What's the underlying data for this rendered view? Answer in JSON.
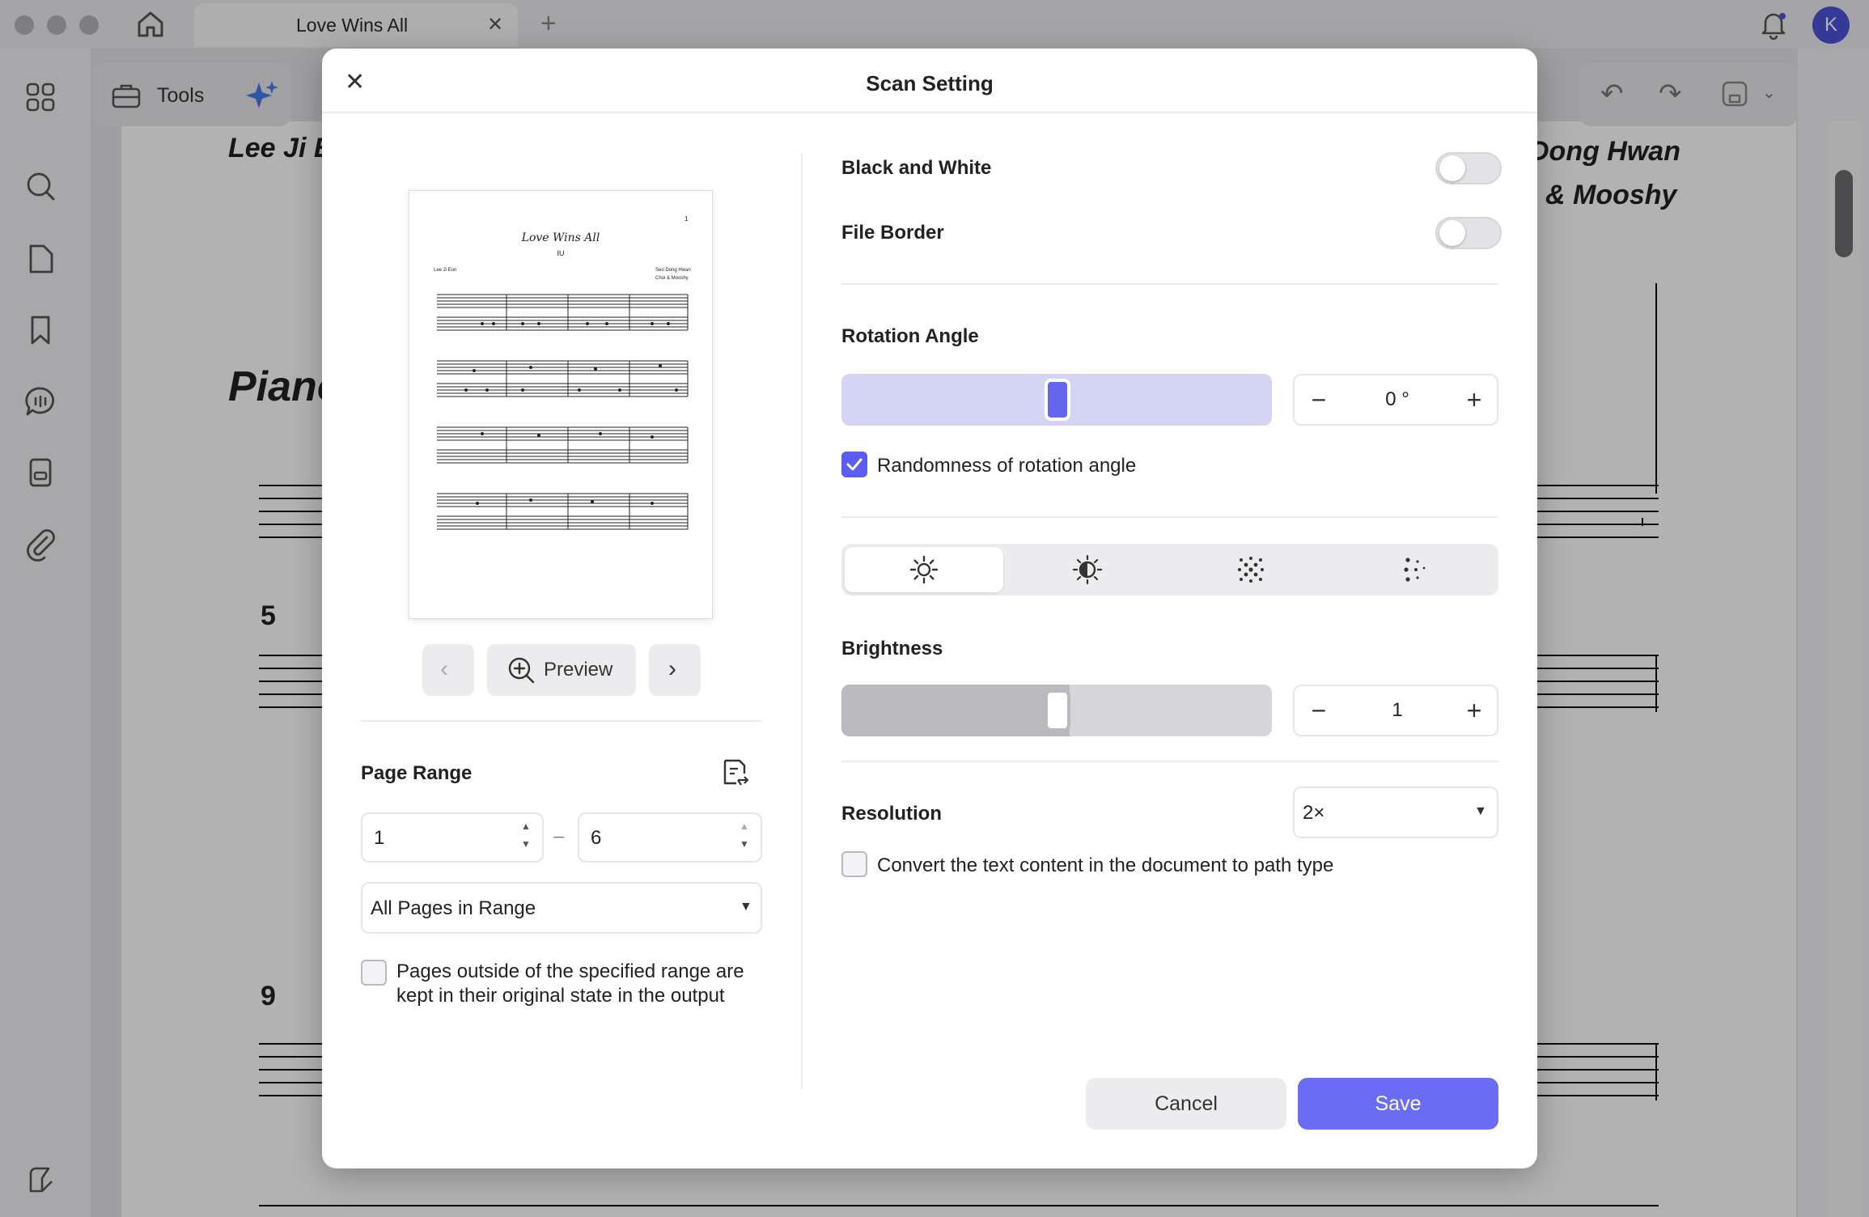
{
  "window": {
    "tab_title": "Love Wins All",
    "avatar_letter": "K"
  },
  "toolbar": {
    "tools_label": "Tools"
  },
  "background_document": {
    "left_header": "Lee Ji E",
    "right_header_1": "Dong Hwan",
    "right_header_2": "& Mooshy",
    "instrument": "Piano",
    "measure_5": "5",
    "measure_9": "9"
  },
  "dialog": {
    "title": "Scan Setting",
    "preview": {
      "sheet_title": "Love Wins All",
      "sheet_subtitle": "IU",
      "sheet_left_credit": "Lee Ji Eun",
      "sheet_right_credit_1": "Seo Dong Hwan",
      "sheet_right_credit_2": "Choi & Mooshy",
      "sheet_page_number": "1",
      "preview_button": "Preview"
    },
    "page_range": {
      "label": "Page Range",
      "from": "1",
      "dash": "–",
      "to": "6",
      "selection": "All Pages in Range",
      "keep_outside_label": "Pages outside of the specified range are kept in their original state in the output",
      "keep_outside_checked": false
    },
    "settings": {
      "black_white_label": "Black and White",
      "black_white_on": false,
      "file_border_label": "File Border",
      "file_border_on": false,
      "rotation_label": "Rotation Angle",
      "rotation_value": "0 °",
      "rotation_position": 0.5,
      "randomness_label": "Randomness of rotation angle",
      "randomness_checked": true,
      "adjust_tabs": [
        "brightness-icon",
        "contrast-icon",
        "sharpness-icon",
        "noise-icon"
      ],
      "active_adjust_tab": 0,
      "brightness_label": "Brightness",
      "brightness_value": "1",
      "brightness_position": 0.5,
      "resolution_label": "Resolution",
      "resolution_value": "2×",
      "convert_text_label": "Convert the text content in the document to path type",
      "convert_text_checked": false
    },
    "cancel_label": "Cancel",
    "save_label": "Save"
  },
  "colors": {
    "accent": "#5b5cf0",
    "save_button": "#6a6cf5",
    "rotation_slider": "#d4d5f4",
    "brightness_slider": "#d6d6da"
  }
}
